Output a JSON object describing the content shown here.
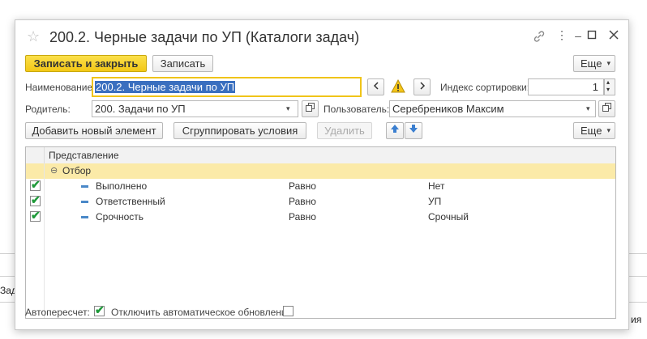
{
  "background": {
    "left_text": "Зад",
    "right_text": "ия"
  },
  "window": {
    "title": "200.2. Черные задачи по УП (Каталоги задач)"
  },
  "toolbar": {
    "save_close": "Записать и закрыть",
    "save": "Записать",
    "more": "Еще"
  },
  "form": {
    "name_label": "Наименование:",
    "name_value": "200.2. Черные задачи по УП",
    "sort_label": "Индекс сортировки:",
    "sort_value": "1",
    "parent_label": "Родитель:",
    "parent_value": "200. Задачи по УП",
    "user_label": "Пользователь:",
    "user_value": "Серебреников  Максим"
  },
  "toolbar2": {
    "add": "Добавить новый элемент",
    "group": "Сгруппировать условия",
    "delete": "Удалить",
    "more": "Еще"
  },
  "table": {
    "header": "Представление",
    "group_row": "Отбор",
    "rows": [
      {
        "name": "Выполнено",
        "op": "Равно",
        "value": "Нет",
        "checked": true
      },
      {
        "name": "Ответственный",
        "op": "Равно",
        "value": "УП",
        "checked": true
      },
      {
        "name": "Срочность",
        "op": "Равно",
        "value": "Срочный",
        "checked": true
      }
    ]
  },
  "footer": {
    "auto_label": "Автопересчет:",
    "disable_label": "Отключить автоматическое обновление",
    "auto_checked": true,
    "disable_checked": false
  },
  "colors": {
    "accent": "#f3c716",
    "selection": "#3a6fbf",
    "group_row": "#fbeaa8",
    "check": "#1f9a3a"
  }
}
